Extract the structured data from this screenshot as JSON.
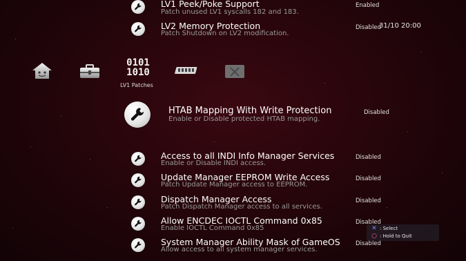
{
  "clock": "31/10 20:00",
  "categories": [
    {
      "icon": "home-icon"
    },
    {
      "icon": "toolbox-icon"
    },
    {
      "icon": "binary-icon",
      "glyph_line1": "0101",
      "glyph_line2": "1010",
      "label": "LV1 Patches"
    },
    {
      "icon": "memory-chip-icon"
    },
    {
      "icon": "folder-icon"
    }
  ],
  "items": [
    {
      "title": "LV1 Peek/Poke Support",
      "subtitle": "Patch unused LV1 syscalls 182 and 183.",
      "status": "Enabled",
      "icon": "wrench-icon"
    },
    {
      "title": "LV2 Memory Protection",
      "subtitle": "Patch Shutdown on LV2 modification.",
      "status": "Disabled",
      "icon": "wrench-icon"
    },
    {
      "title": "HTAB Mapping With Write Protection",
      "subtitle": "Enable or Disable protected HTAB mapping.",
      "status": "Disabled",
      "icon": "wrench-icon"
    },
    {
      "title": "Access to all INDI Info Manager Services",
      "subtitle": "Enable or Disable INDI access.",
      "status": "Disabled",
      "icon": "wrench-icon"
    },
    {
      "title": "Update Manager EEPROM Write Access",
      "subtitle": "Patch Update Manager access to EEPROM.",
      "status": "Disabled",
      "icon": "wrench-icon"
    },
    {
      "title": "Dispatch Manager Access",
      "subtitle": "Patch Dispatch Manager access to all services.",
      "status": "Disabled",
      "icon": "wrench-icon"
    },
    {
      "title": "Allow ENCDEC IOCTL Command 0x85",
      "subtitle": "Enable IOCTL Command 0x85",
      "status": "Disabled",
      "icon": "wrench-icon"
    },
    {
      "title": "System Manager Ability Mask of GameOS",
      "subtitle": "Allow access to all system manager services.",
      "status": "Disabled",
      "icon": "wrench-icon"
    }
  ],
  "hints": [
    {
      "button": "✕",
      "label": ": Select",
      "color": "#6d8bff"
    },
    {
      "button": "○",
      "label": ": Hold to Quit",
      "color": "#ff6b9a"
    }
  ]
}
